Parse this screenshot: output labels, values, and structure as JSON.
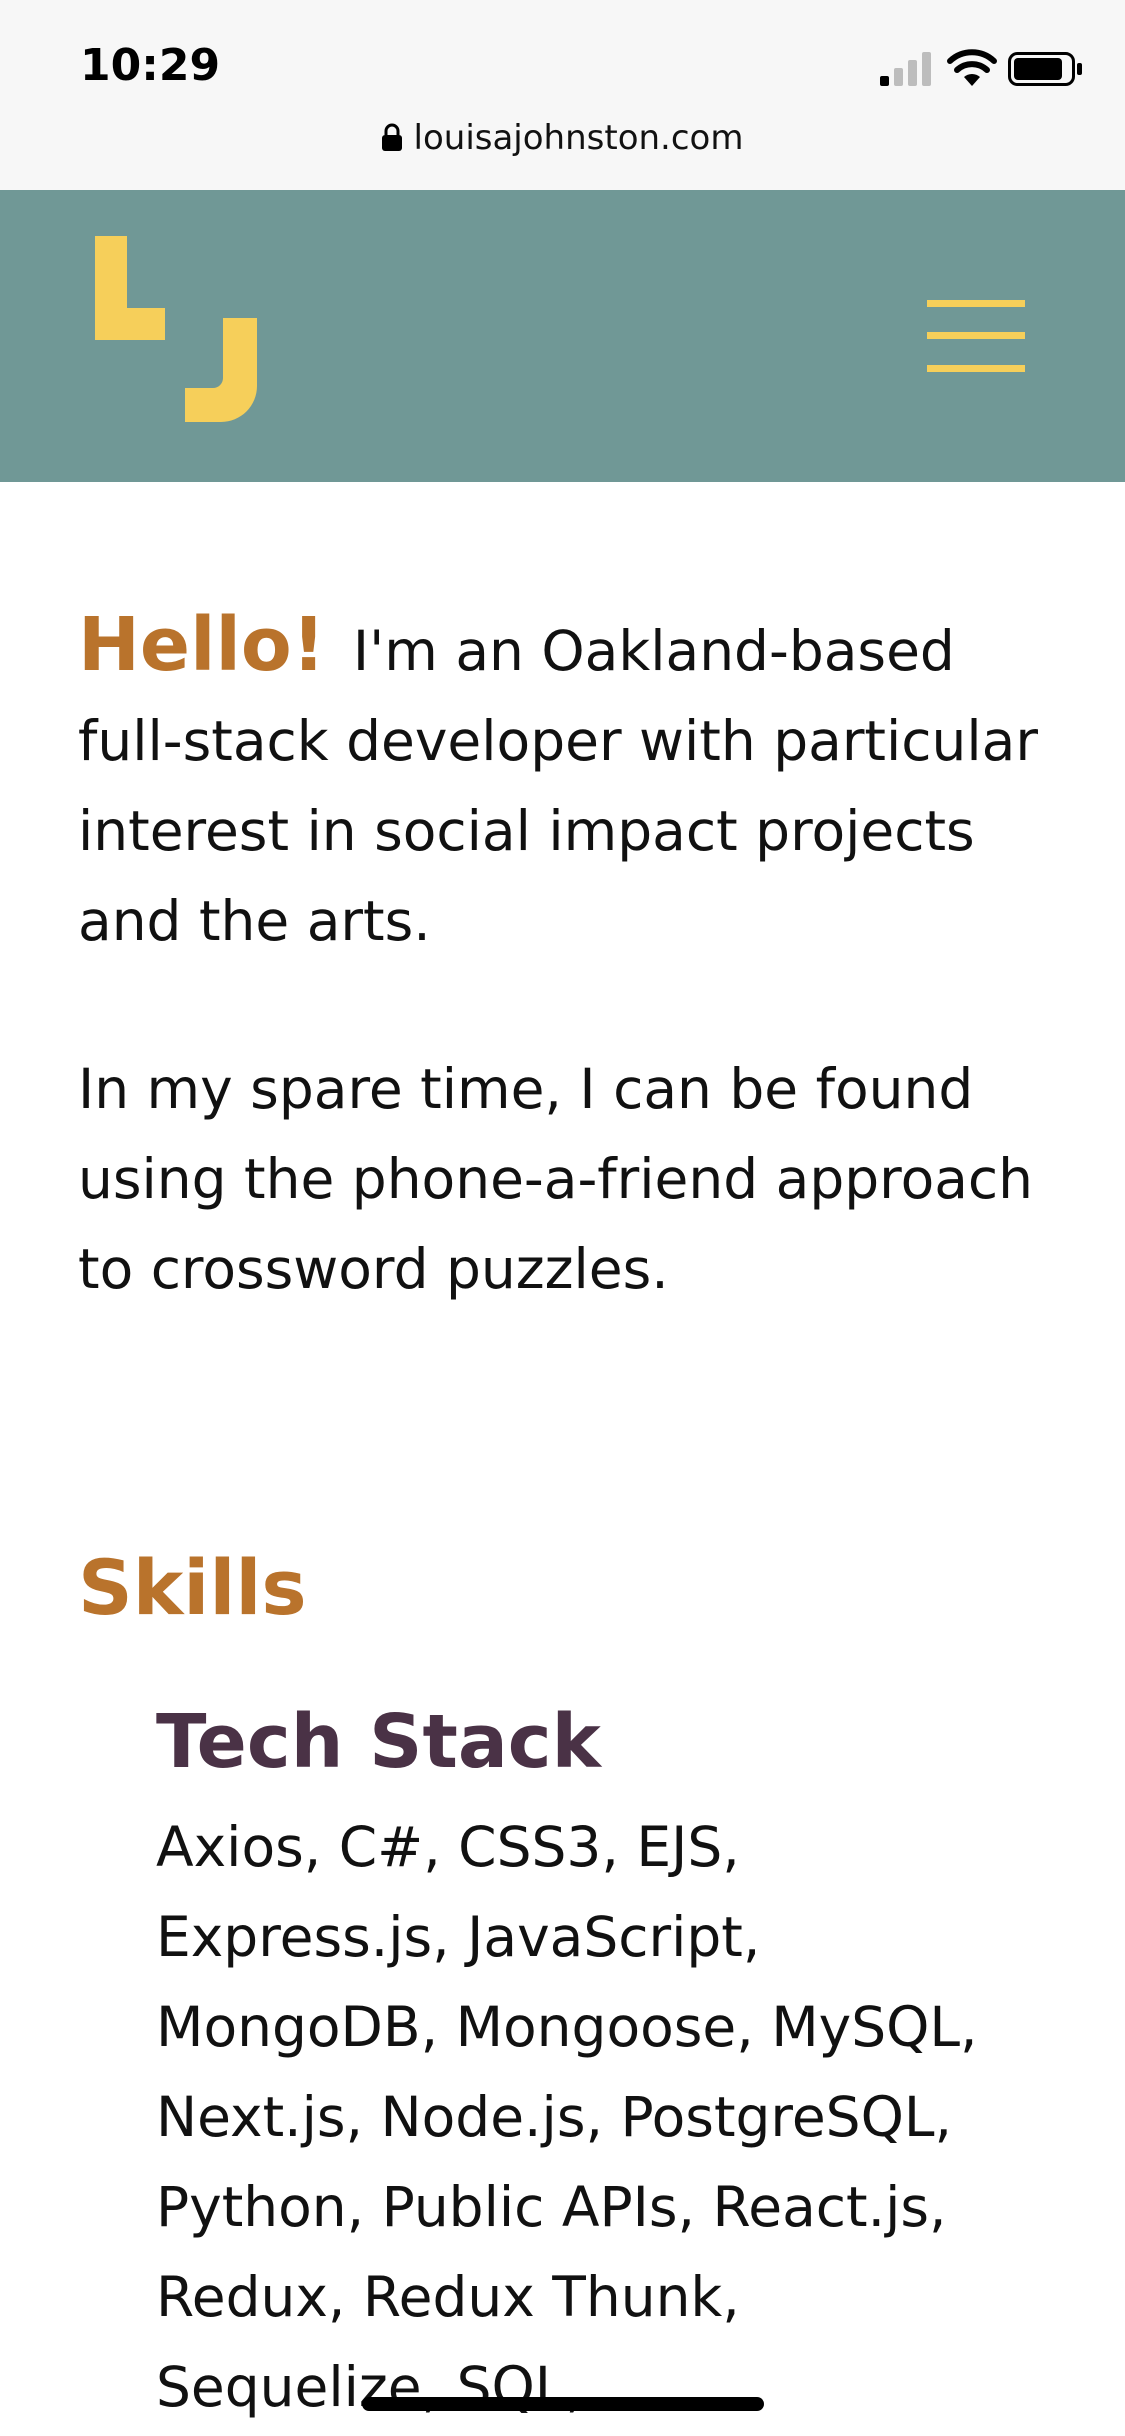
{
  "status_bar": {
    "time": "10:29",
    "icons": [
      "signal-icon",
      "wifi-icon",
      "battery-icon"
    ]
  },
  "browser": {
    "url": "louisajohnston.com",
    "lock_icon": "lock-icon"
  },
  "header": {
    "logo_letters": "LJ",
    "menu_icon": "hamburger-menu-icon",
    "colors": {
      "background": "#709896",
      "accent": "#f6cf5a"
    }
  },
  "intro": {
    "greeting": "Hello!",
    "text": "I'm an Oakland-based full-stack developer with particular interest in social impact projects and the arts.",
    "spare_time": "In my spare time, I can be found using the phone-a-friend approach to crossword puzzles."
  },
  "skills": {
    "heading": "Skills",
    "tech_stack": {
      "heading": "Tech Stack",
      "items": "Axios, C#, CSS3, EJS, Express.js, JavaScript, MongoDB, Mongoose, MySQL, Next.js, Node.js, PostgreSQL, Python, Public APIs, React.js, Redux, Redux Thunk, Sequelize, SQL,"
    }
  },
  "colors": {
    "heading_orange": "#b9732c",
    "heading_purple": "#4a3246"
  }
}
